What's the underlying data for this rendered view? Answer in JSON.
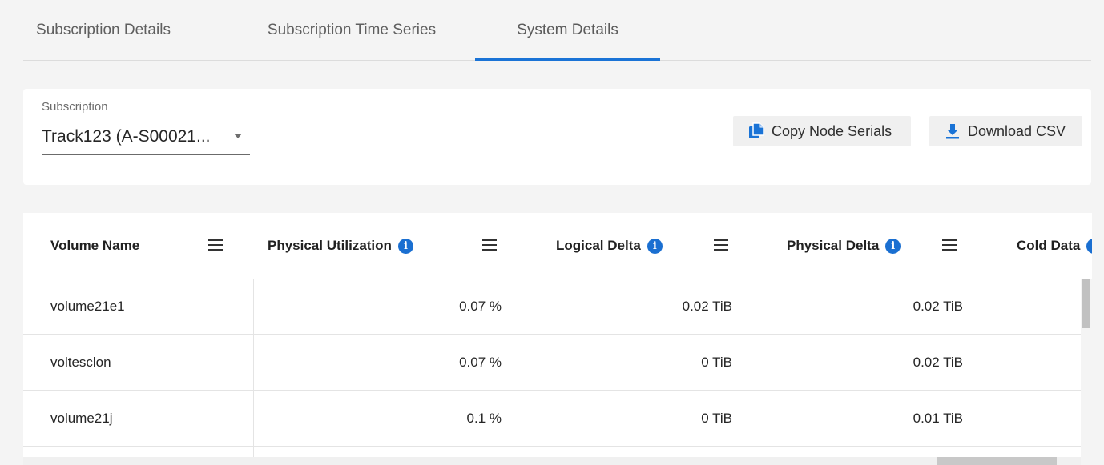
{
  "tabs": [
    {
      "label": "Subscription Details",
      "active": false
    },
    {
      "label": "Subscription Time Series",
      "active": false
    },
    {
      "label": "System Details",
      "active": true
    }
  ],
  "subscription": {
    "label": "Subscription",
    "value": "Track123 (A-S00021..."
  },
  "actions": {
    "copy_label": "Copy Node Serials",
    "download_label": "Download CSV"
  },
  "table": {
    "columns": [
      "Volume Name",
      "Physical Utilization",
      "Logical Delta",
      "Physical Delta",
      "Cold Data"
    ],
    "info_glyph": "i",
    "rows": [
      {
        "name": "volume21e1",
        "physical_utilization": "0.07 %",
        "logical_delta": "0.02 TiB",
        "physical_delta": "0.02 TiB"
      },
      {
        "name": "voltesclon",
        "physical_utilization": "0.07 %",
        "logical_delta": "0 TiB",
        "physical_delta": "0.02 TiB"
      },
      {
        "name": "volume21j",
        "physical_utilization": "0.1 %",
        "logical_delta": "0 TiB",
        "physical_delta": "0.01 TiB"
      }
    ]
  },
  "colors": {
    "accent": "#1a73d6",
    "info_icon": "#1a6fd1",
    "background": "#f4f4f4"
  },
  "icons": {
    "copy": "copy-icon",
    "download": "download-icon",
    "info": "info-icon",
    "column_menu": "menu-icon",
    "dropdown": "chevron-down-icon"
  }
}
